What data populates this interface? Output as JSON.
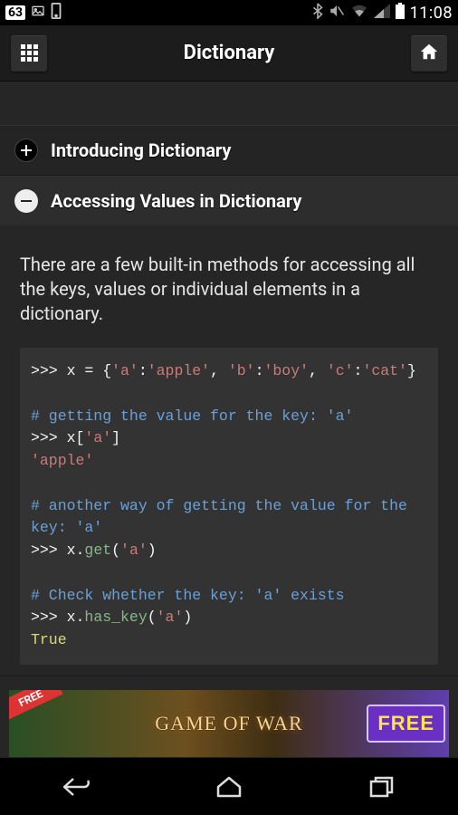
{
  "status": {
    "badge": "63",
    "clock": "11:08"
  },
  "header": {
    "title": "Dictionary"
  },
  "accordion": {
    "item1": {
      "label": "Introducing Dictionary"
    },
    "item2": {
      "label": "Accessing Values in Dictionary"
    }
  },
  "body": {
    "paragraph": "There are a few built-in methods for accessing all the keys, values or individual elements in a dictionary."
  },
  "code": {
    "l1a": ">>> x = {",
    "l1b": "'a'",
    "l1c": ":",
    "l1d": "'apple'",
    "l1e": ", ",
    "l1f": "'b'",
    "l1g": ":",
    "l1h": "'boy'",
    "l1i": ", ",
    "l1j": "'c'",
    "l1k": ":",
    "l1l": "'cat'",
    "l1m": "}",
    "c1": "# getting the value for the key: 'a'",
    "l2a": ">>> x[",
    "l2b": "'a'",
    "l2c": "]",
    "r1": "'apple'",
    "c2": "# another way of getting the value for the key: 'a'",
    "l3a": ">>> x.",
    "l3b": "get",
    "l3c": "(",
    "l3d": "'a'",
    "l3e": ")",
    "c3": "# Check whether the key: 'a' exists",
    "l4a": ">>> x.",
    "l4b": "has_key",
    "l4c": "(",
    "l4d": "'a'",
    "l4e": ")",
    "r2": "True"
  },
  "ad": {
    "title": "GAME OF WAR",
    "free_left": "FREE",
    "free_right": "FREE"
  }
}
